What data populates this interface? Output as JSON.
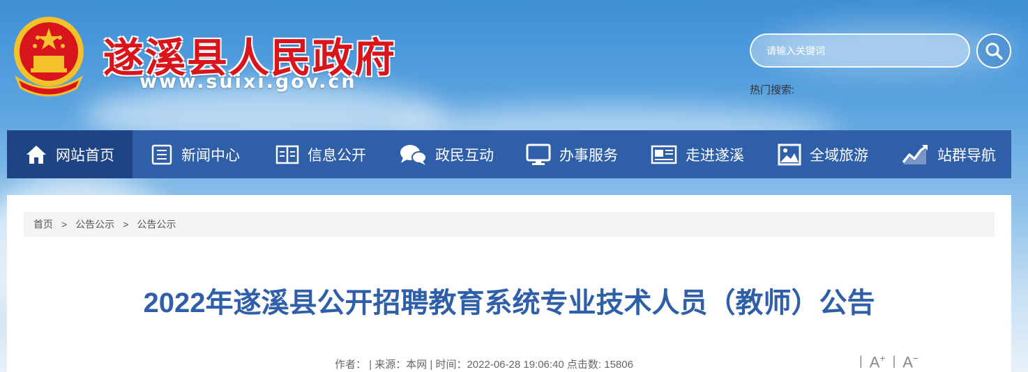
{
  "header": {
    "site_title": "遂溪县人民政府",
    "site_url": "www.suixi.gov.cn",
    "search": {
      "placeholder": "请输入关键词"
    },
    "hot_search_label": "热门搜索:"
  },
  "nav": {
    "items": [
      {
        "label": "网站首页",
        "icon": "home-icon",
        "active": true
      },
      {
        "label": "新闻中心",
        "icon": "news-icon"
      },
      {
        "label": "信息公开",
        "icon": "book-icon"
      },
      {
        "label": "政民互动",
        "icon": "chat-icon"
      },
      {
        "label": "办事服务",
        "icon": "monitor-icon"
      },
      {
        "label": "走进遂溪",
        "icon": "newspaper-icon"
      },
      {
        "label": "全域旅游",
        "icon": "picture-icon"
      },
      {
        "label": "站群导航",
        "icon": "chart-icon"
      }
    ]
  },
  "breadcrumb": {
    "items": [
      "首页",
      "公告公示",
      "公告公示"
    ],
    "separator": ">"
  },
  "article": {
    "title": "2022年遂溪县公开招聘教育系统专业技术人员（教师）公告",
    "meta": "作者：  | 来源：本网 | 时间：2022-06-28 19:06:40 点击数: 15806"
  },
  "font_controls": {
    "increase_label": "A",
    "increase_symbol": "+",
    "decrease_label": "A",
    "decrease_symbol": "−",
    "divider": "|"
  },
  "colors": {
    "nav_bg": "#2f5fa8",
    "nav_active_bg": "#1f4485",
    "title_red": "#d9141b",
    "article_title": "#2f5fa8"
  }
}
